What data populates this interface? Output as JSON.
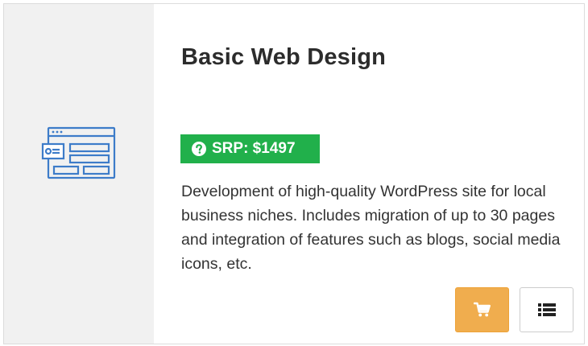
{
  "product": {
    "title": "Basic Web Design",
    "srp_label": "SRP: $1497",
    "description": "Development of high-quality WordPress site for local business niches. Includes migration of up to 30 pages and integration of features such as blogs, social media icons, etc."
  },
  "actions": {
    "cart_icon": "shopping-cart-icon",
    "details_icon": "list-icon"
  },
  "colors": {
    "badge": "#21b04b",
    "cart_button": "#f0ad4e",
    "icon_panel": "#f1f1f1",
    "icon_stroke": "#3d7cc9"
  }
}
